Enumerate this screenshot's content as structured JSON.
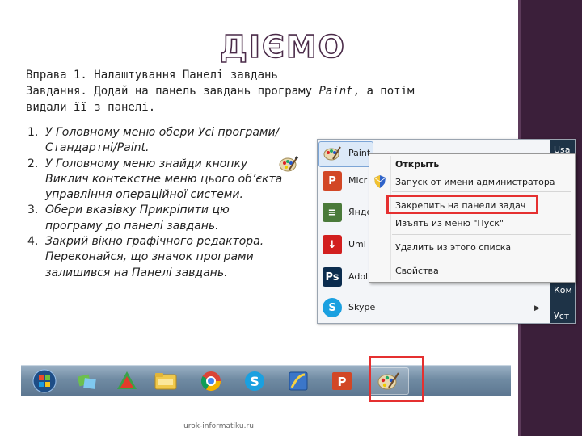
{
  "slide": {
    "title": "ДІЄМО",
    "intro": {
      "line1": "Вправа 1. Налаштування Панелі завдань",
      "line2_prefix": "Завдання. Додай на панель завдань програму ",
      "line2_app": "Paint",
      "line2_suffix": ", а потім",
      "line3": "видали її з панелі."
    },
    "steps": [
      {
        "num": "1.",
        "text": "У Головному меню обери Усі програми/Стандартні/Paint."
      },
      {
        "num": "2.",
        "text": "У Головному меню знайди кнопку Виклич контекстне меню цього об’єкта управління операційної системи."
      },
      {
        "num": "3.",
        "text": "Обери вказівку Прикріпити цю програму до панелі завдань."
      },
      {
        "num": "4.",
        "text": "Закрий вікно графічного редактора. Переконайся, що значок програми залишився на Панелі завдань."
      }
    ],
    "footer": "urok-informatiku.ru"
  },
  "start_menu": {
    "items": [
      {
        "label": "Paint",
        "icon": "paint-icon",
        "color": "#5b8fd6"
      },
      {
        "label": "Micr",
        "icon": "powerpoint-icon",
        "color": "#d24726"
      },
      {
        "label": "Янде",
        "icon": "document-icon",
        "color": "#4a7a3a"
      },
      {
        "label": "Uml",
        "icon": "download-icon",
        "color": "#d21f1f"
      },
      {
        "label": "Adol",
        "icon": "photoshop-icon",
        "color": "#0b2c4e"
      },
      {
        "label": "Skype",
        "icon": "skype-icon",
        "color": "#1aa0e0"
      }
    ],
    "right_pane": [
      "Usa",
      "Ком",
      "Уст"
    ]
  },
  "context_menu": {
    "items": [
      {
        "label": "Открыть",
        "bold": true
      },
      {
        "label": "Запуск от имени администратора"
      },
      {
        "label": "Закрепить на панели задач"
      },
      {
        "label": "Изъять из меню \"Пуск\""
      },
      {
        "label": "Удалить из этого списка"
      },
      {
        "label": "Свойства"
      }
    ]
  },
  "taskbar": {
    "buttons": [
      {
        "name": "start-orb-icon"
      },
      {
        "name": "windows-explorer-icon"
      },
      {
        "name": "media-center-icon"
      },
      {
        "name": "folder-icon"
      },
      {
        "name": "chrome-icon"
      },
      {
        "name": "skype-icon"
      },
      {
        "name": "paint-alt-icon"
      },
      {
        "name": "powerpoint-icon"
      },
      {
        "name": "paint-icon",
        "pinned": true
      }
    ]
  },
  "colors": {
    "accent_side": "#3b1f3a",
    "highlight_box": "#e53030",
    "taskbar": "#6f8aa2"
  }
}
